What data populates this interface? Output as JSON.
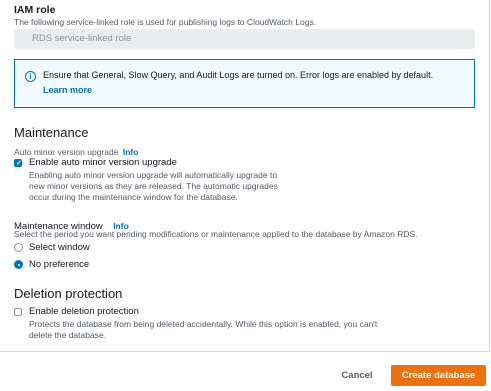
{
  "iam_role": {
    "label": "IAM role",
    "description": "The following service-linked role is used for publishing logs to CloudWatch Logs.",
    "value": "RDS service-linked role"
  },
  "alert": {
    "icon": "info-circle-icon",
    "text": "Ensure that General, Slow Query, and Audit Logs are turned on. Error logs are enabled by default.",
    "link": "Learn more",
    "accent": "#0073bb"
  },
  "maintenance": {
    "heading": "Maintenance",
    "auto_upgrade_label": "Auto minor version upgrade",
    "info": "Info",
    "checkbox_label": "Enable auto minor version upgrade",
    "checkbox_checked": true,
    "checkbox_desc": [
      "Enabling auto minor version upgrade will automatically upgrade to",
      "new minor versions as they are released. The automatic upgrades",
      "occur during the maintenance window for the database."
    ],
    "window_label": "Maintenance window",
    "window_info": "Info",
    "window_desc": "Select the period you want pending modifications or maintenance applied to the database by Amazon RDS.",
    "options": [
      "Select window",
      "No preference"
    ],
    "selected_option": "No preference"
  },
  "deletion": {
    "heading": "Deletion protection",
    "checkbox_label": "Enable deletion protection",
    "checkbox_checked": false,
    "desc": [
      "Protects the database from being deleted accidentally. While this option is enabled, you can't",
      "delete the database."
    ]
  },
  "footer": {
    "cancel": "Cancel",
    "create": "Create database",
    "primary_color": "#ec7211"
  }
}
